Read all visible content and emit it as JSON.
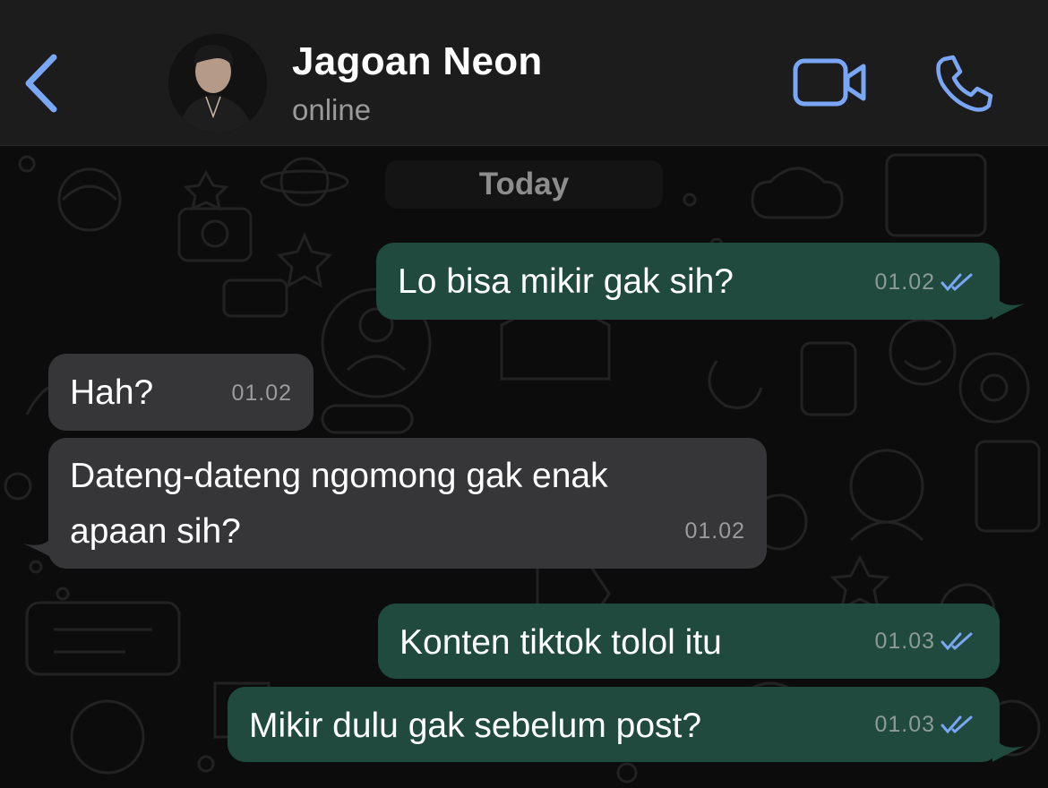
{
  "header": {
    "contact_name": "Jagoan Neon",
    "status": "online",
    "accent_color": "#7aa7f5"
  },
  "chat": {
    "date_label": "Today",
    "messages": [
      {
        "direction": "outgoing",
        "text": "Lo bisa mikir gak sih?",
        "time": "01.02",
        "read": true
      },
      {
        "direction": "incoming",
        "text": "Hah?",
        "time": "01.02"
      },
      {
        "direction": "incoming",
        "lines": [
          "Dateng-dateng ngomong gak enak",
          "apaan sih?"
        ],
        "time": "01.02"
      },
      {
        "direction": "outgoing",
        "text": "Konten tiktok tolol itu",
        "time": "01.03",
        "read": true
      },
      {
        "direction": "outgoing",
        "text": "Mikir dulu gak sebelum post?",
        "time": "01.03",
        "read": true
      }
    ]
  },
  "colors": {
    "outgoing_bubble": "#1f4a3d",
    "incoming_bubble": "#363638",
    "read_tick": "#7aa7f5"
  }
}
